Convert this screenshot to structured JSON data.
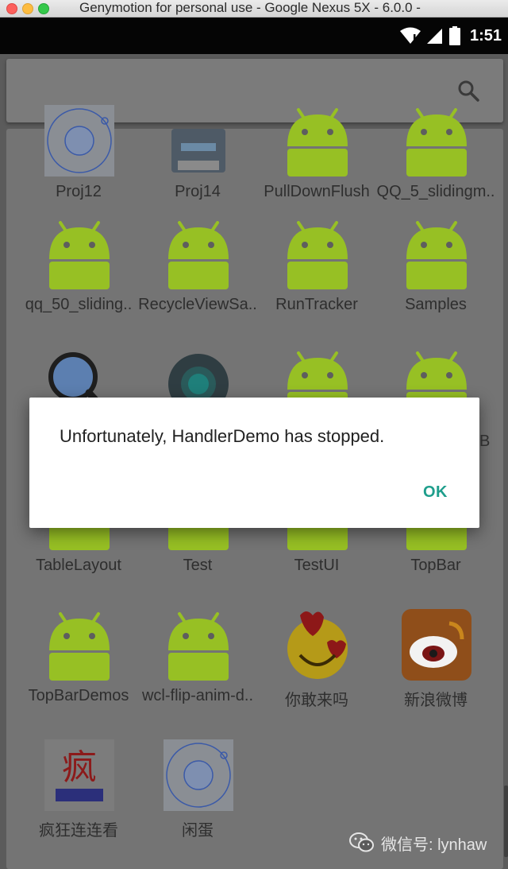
{
  "window": {
    "title": "Genymotion for personal use - Google Nexus 5X - 6.0.0 -"
  },
  "status_bar": {
    "time": "1:51",
    "icons": [
      "wifi-icon",
      "signal-icon",
      "battery-icon"
    ]
  },
  "search": {
    "icon": "search-icon"
  },
  "apps": [
    {
      "label": "Proj12",
      "icon": "radar-app-icon"
    },
    {
      "label": "Proj14",
      "icon": "printer-app-icon"
    },
    {
      "label": "PullDownFlush",
      "icon": "android-app-icon"
    },
    {
      "label": "QQ_5_slidingm..",
      "icon": "android-app-icon"
    },
    {
      "label": "qq_50_sliding..",
      "icon": "android-app-icon"
    },
    {
      "label": "RecycleViewSa..",
      "icon": "android-app-icon"
    },
    {
      "label": "RunTracker",
      "icon": "android-app-icon"
    },
    {
      "label": "Samples",
      "icon": "android-app-icon"
    },
    {
      "label": "",
      "icon": "magnifier-app-icon"
    },
    {
      "label": "",
      "icon": "settings-app-icon"
    },
    {
      "label": "",
      "icon": "android-app-icon"
    },
    {
      "label": "",
      "icon": "android-app-icon"
    },
    {
      "label": "TableLayout",
      "icon": "android-app-icon"
    },
    {
      "label": "Test",
      "icon": "android-app-icon"
    },
    {
      "label": "TestUI",
      "icon": "android-app-icon"
    },
    {
      "label": "TopBar",
      "icon": "android-app-icon"
    },
    {
      "label": "TopBarDemos",
      "icon": "android-app-icon"
    },
    {
      "label": "wcl-flip-anim-d..",
      "icon": "android-app-icon"
    },
    {
      "label": "你敢来吗",
      "icon": "heart-smiley-app-icon"
    },
    {
      "label": "新浪微博",
      "icon": "weibo-app-icon"
    },
    {
      "label": "疯狂连连看",
      "icon": "crazy-java-app-icon"
    },
    {
      "label": "闲蛋",
      "icon": "radar-app-icon"
    }
  ],
  "dialog": {
    "message": "Unfortunately, HandlerDemo has stopped.",
    "ok_label": "OK",
    "partial_text_right": "B"
  },
  "watermark": {
    "text": "微信号: lynhaw",
    "icon": "wechat-icon"
  },
  "colors": {
    "android_green": "#97c024",
    "dialog_button": "#1e9e8c",
    "dim_overlay": "#747474"
  }
}
